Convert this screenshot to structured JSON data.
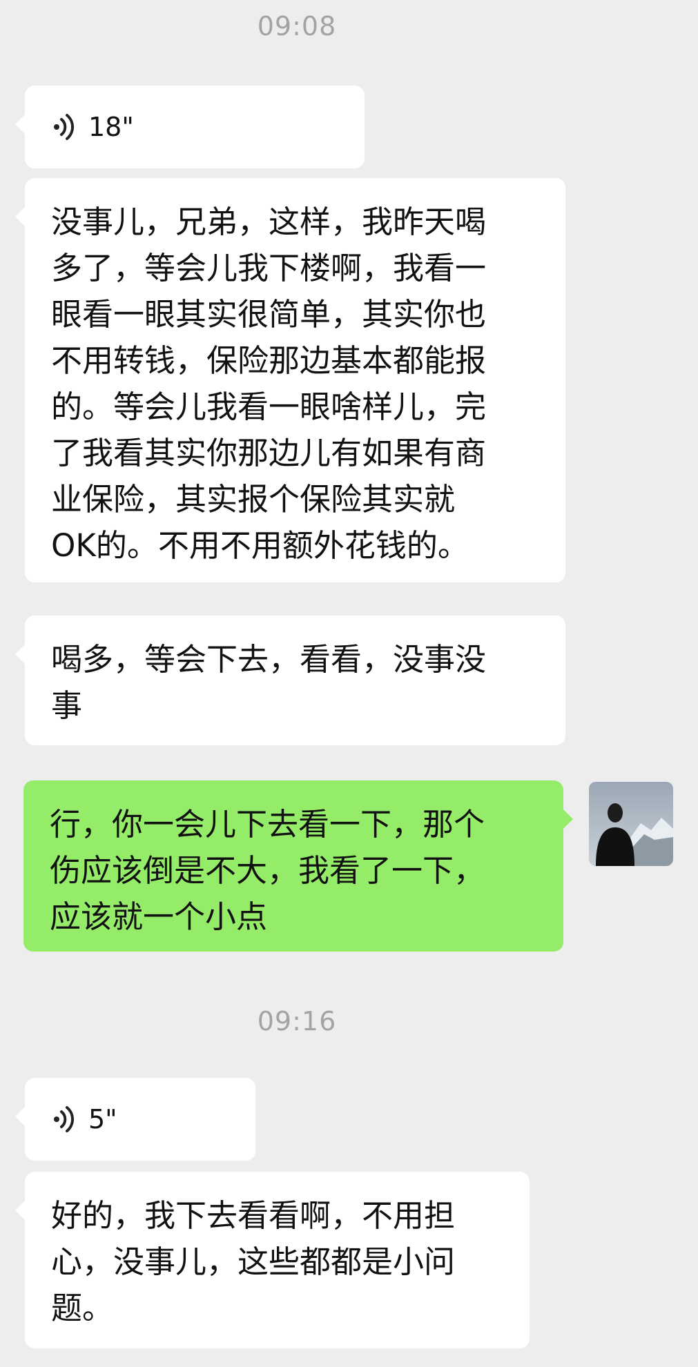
{
  "timestamps": [
    "09:08",
    "09:16"
  ],
  "messages": [
    {
      "type": "voice",
      "duration": "18\""
    },
    {
      "type": "text",
      "text": "没事儿，兄弟，这样，我昨天喝\n多了，等会儿我下楼啊，我看一\n眼看一眼其实很简单，其实你也\n不用转钱，保险那边基本都能报\n的。等会儿我看一眼啥样儿，完\n了我看其实你那边儿有如果有商\n业保险，其实报个保险其实就\nOK的。不用不用额外花钱的。"
    },
    {
      "type": "text",
      "text": "喝多，等会下去，看看，没事没\n事"
    },
    {
      "type": "text_self",
      "text": "行，你一会儿下去看一下，那个\n伤应该倒是不大，我看了一下，\n应该就一个小点"
    },
    {
      "type": "voice",
      "duration": "5\""
    },
    {
      "type": "text",
      "text": "好的，我下去看看啊，不用担\n心，没事儿，这些都都是小问\n题。"
    }
  ],
  "colors": {
    "background": "#ededed",
    "bubble_in": "#ffffff",
    "bubble_out": "#95ec69",
    "timestamp": "#a3a3a3"
  },
  "icons": {
    "voice": "voice-wave-icon",
    "avatar": "user-avatar"
  }
}
